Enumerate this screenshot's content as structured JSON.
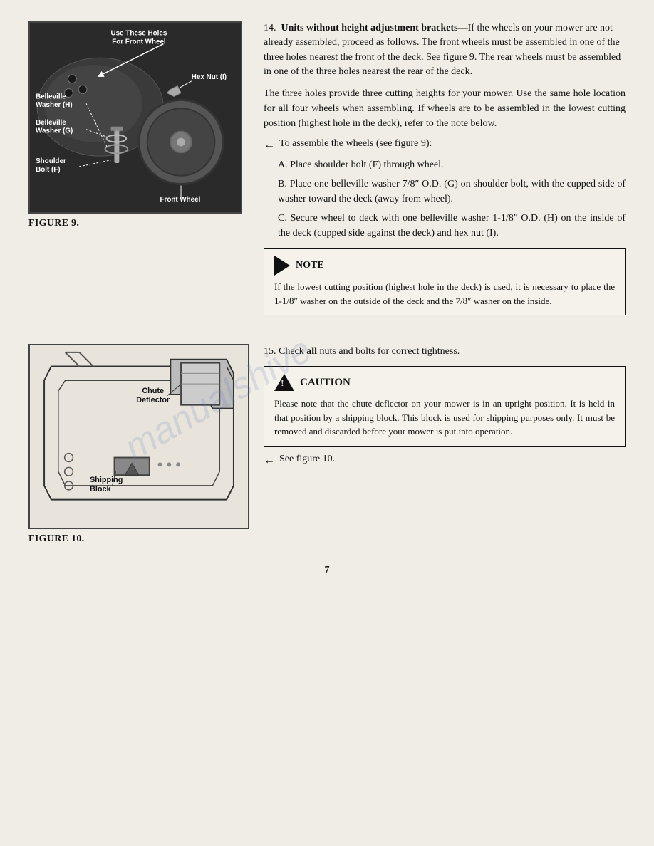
{
  "figures": {
    "fig9": {
      "label": "FIGURE 9.",
      "labels_in_image": {
        "holes": "Use These Holes\nFor Front Wheel",
        "hex_nut": "Hex Nut (I)",
        "belleville_h": "Belleville\nWasher (H)",
        "belleville_g": "Belleville\nWasher (G)",
        "shoulder_bolt": "Shoulder\nBolt (F)",
        "front_wheel": "Front Wheel"
      }
    },
    "fig10": {
      "label": "FIGURE 10.",
      "labels_in_image": {
        "chute": "Chute\nDeflector",
        "shipping": "Shipping\nBlock"
      }
    }
  },
  "content": {
    "item14": {
      "number": "14.",
      "header": "Units without height adjustment brackets—",
      "header_rest": "If the wheels on your mower are not already assembled, proceed as follows. The front wheels must be assembled in one of the three holes nearest the front of the deck. See figure 9. The rear wheels must be assembled in one of the three holes nearest the rear of the deck.",
      "paragraph2": "The three holes provide three cutting heights for your mower. Use the same hole location for all four wheels when assembling. If wheels are to be assembled in the lowest cutting position (highest hole in the deck), refer to the note below.",
      "assemble_intro": "To assemble the wheels (see figure 9):",
      "steps": [
        {
          "letter": "A.",
          "text": "Place shoulder bolt (F) through wheel."
        },
        {
          "letter": "B.",
          "text": "Place one belleville washer 7/8″ O.D. (G) on shoulder bolt, with the cupped side of washer toward the deck (away from wheel)."
        },
        {
          "letter": "C.",
          "text": "Secure wheel to deck with one belleville washer 1-1/8″ O.D. (H) on the inside of the deck (cupped side against the deck) and hex nut (I)."
        }
      ],
      "note_header": "NOTE",
      "note_text": "If the lowest cutting position (highest hole in the deck) is used, it is necessary to place the 1-1/8″ washer on the outside of the deck and the 7/8″ washer on the inside."
    },
    "item15": {
      "number": "15.",
      "text": "Check ",
      "bold": "all",
      "text2": " nuts and bolts for correct tightness.",
      "caution_header": "CAUTION",
      "caution_text": "Please note that the chute deflector on your mower is in an upright position. It is held in that position by a shipping block. This block is used for shipping purposes only. It must be removed and discarded before your mower is put into operation. See figure 10."
    },
    "page_number": "7"
  },
  "watermark": "manualshive",
  "arrows": {
    "fig9_arrow": "←",
    "fig10_arrow": "←"
  }
}
